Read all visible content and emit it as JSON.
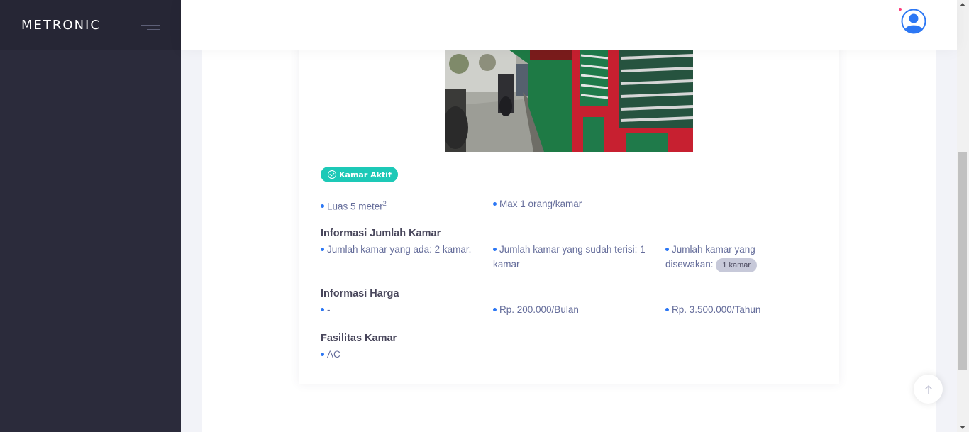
{
  "brand": {
    "logo": "METRONIC"
  },
  "header": {
    "avatar_icon": "user-circle-icon"
  },
  "room": {
    "status": "Kamar Aktif",
    "specs": {
      "luas_prefix": "Luas 5 meter",
      "luas_sup": "2",
      "max": "Max 1 orang/kamar"
    },
    "jumlah": {
      "title": "Informasi Jumlah Kamar",
      "ada": "Jumlah kamar yang ada: 2 kamar.",
      "terisi": "Jumlah kamar yang sudah terisi: 1 kamar",
      "disewakan_label": "Jumlah kamar yang disewakan:",
      "disewakan_value": "1 kamar"
    },
    "harga": {
      "title": "Informasi Harga",
      "harian": "-",
      "bulanan": "Rp. 200.000/Bulan",
      "tahunan": "Rp. 3.500.000/Tahun"
    },
    "fasilitas": {
      "title": "Fasilitas Kamar",
      "items": [
        "AC"
      ]
    }
  },
  "colors": {
    "sidebar": "#2b2b3b",
    "badge_success": "#1dc9b7",
    "bullet": "#2c77f4"
  }
}
